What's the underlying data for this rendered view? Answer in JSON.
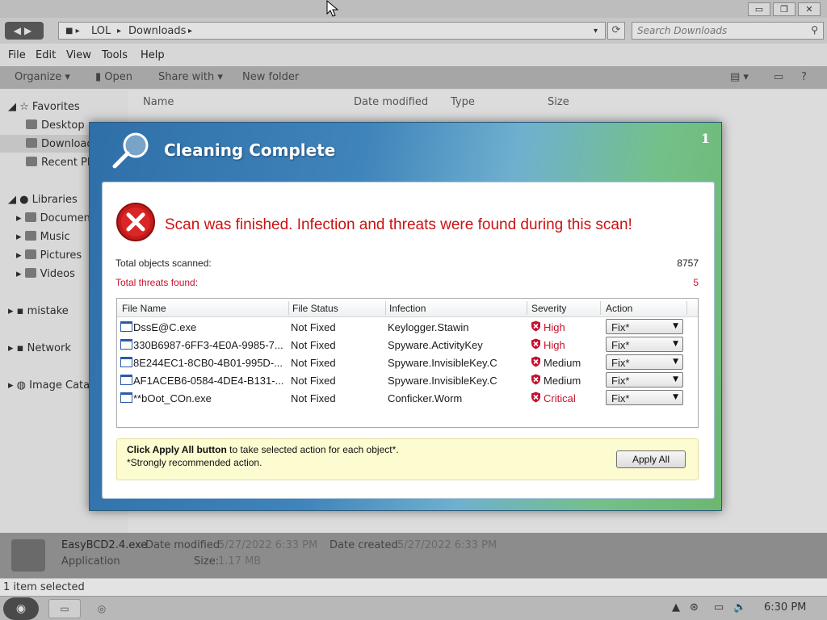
{
  "explorer": {
    "window_controls": [
      "▭",
      "❐",
      "✕"
    ],
    "nav_arrows": "◀▶",
    "breadcrumb": [
      "LOL",
      "Downloads"
    ],
    "refresh_icon": "refresh-icon",
    "search_placeholder": "Search Downloads",
    "menu": [
      "File",
      "Edit",
      "View",
      "Tools",
      "Help"
    ],
    "toolbar": {
      "organize": "Organize ▾",
      "open": "Open",
      "share": "Share with ▾",
      "new_folder": "New folder"
    },
    "nav": {
      "favorites": "Favorites",
      "desktop": "Desktop",
      "downloads": "Download",
      "recent": "Recent Pla",
      "libraries": "Libraries",
      "documents": "Document",
      "music": "Music",
      "pictures": "Pictures",
      "videos": "Videos",
      "mistake": "mistake",
      "network": "Network",
      "image_catalog": "Image Catal"
    },
    "columns": [
      "Name",
      "Date modified",
      "Type",
      "Size"
    ],
    "details": {
      "filename": "EasyBCD2.4.exe",
      "date_modified_label": "Date modified:",
      "date_modified": "5/27/2022 6:33 PM",
      "date_created_label": "Date created:",
      "date_created": "5/27/2022 6:33 PM",
      "type": "Application",
      "size_label": "Size:",
      "size": "1.17 MB"
    },
    "status": "1 item selected"
  },
  "taskbar": {
    "clock": "6:30 PM"
  },
  "dialog": {
    "title": "Cleaning Complete",
    "corner": "1",
    "headline": "Scan was finished. Infection and threats were found during this scan!",
    "objects_label": "Total objects scanned:",
    "objects_value": "8757",
    "threats_label": "Total threats found:",
    "threats_value": "5",
    "columns": [
      "File Name",
      "File Status",
      "Infection",
      "Severity",
      "Action"
    ],
    "rows": [
      {
        "file": "DssE@C.exe",
        "status": "Not Fixed",
        "infection": "Keylogger.Stawin",
        "severity": "High",
        "action": "Fix*"
      },
      {
        "file": "330B6987-6FF3-4E0A-9985-7...",
        "status": "Not Fixed",
        "infection": "Spyware.ActivityKey",
        "severity": "High",
        "action": "Fix*"
      },
      {
        "file": "8E244EC1-8CB0-4B01-995D-...",
        "status": "Not Fixed",
        "infection": "Spyware.InvisibleKey.C",
        "severity": "Medium",
        "action": "Fix*"
      },
      {
        "file": "AF1ACEB6-0584-4DE4-B131-...",
        "status": "Not Fixed",
        "infection": "Spyware.InvisibleKey.C",
        "severity": "Medium",
        "action": "Fix*"
      },
      {
        "file": "**bOot_COn.exe",
        "status": "Not Fixed",
        "infection": "Conficker.Worm",
        "severity": "Critical",
        "action": "Fix*"
      }
    ],
    "notice_bold": "Click Apply All button",
    "notice_rest": " to take selected action for each object*.",
    "notice_line2": "*Strongly recommended action.",
    "apply_label": "Apply All",
    "colors": {
      "headline": "#cc1111",
      "threat": "#c8102e",
      "high": "#c8102e",
      "critical": "#c8102e",
      "medium": "#222222"
    }
  }
}
